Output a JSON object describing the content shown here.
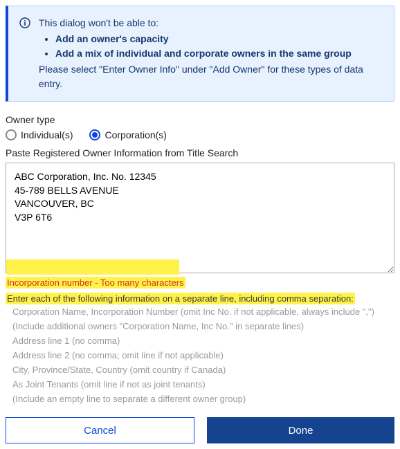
{
  "info": {
    "lead": "This dialog won't be able to:",
    "bullets": [
      "Add an owner's capacity",
      "Add a mix of individual and corporate owners in the same group"
    ],
    "trail": "Please select \"Enter Owner Info\" under \"Add Owner\" for these types of data entry."
  },
  "owner_type": {
    "label": "Owner type",
    "options": {
      "individual": {
        "label": "Individual(s)",
        "selected": false
      },
      "corporation": {
        "label": "Corporation(s)",
        "selected": true
      }
    }
  },
  "paste_label": "Paste Registered Owner Information from Title Search",
  "textarea_value": "ABC Corporation, Inc. No. 12345\n45-789 BELLS AVENUE\nVANCOUVER, BC\nV3P 6T6",
  "error": "Incorporation number - Too many characters",
  "instructions": {
    "heading": "Enter each of the following information on a separate line, including comma separation:",
    "lines": [
      "Corporation Name, Incorporation Number (omit Inc No. if not applicable, always include \",\")",
      "(Include additional owners \"Corporation Name, Inc No.\" in separate lines)",
      "Address line 1 (no comma)",
      "Address line 2 (no comma; omit line if not applicable)",
      "City, Province/State, Country (omit country if Canada)",
      "As Joint Tenants (omit line if not as joint tenants)",
      "(Include an empty line to separate a different owner group)"
    ]
  },
  "buttons": {
    "cancel": "Cancel",
    "done": "Done"
  }
}
